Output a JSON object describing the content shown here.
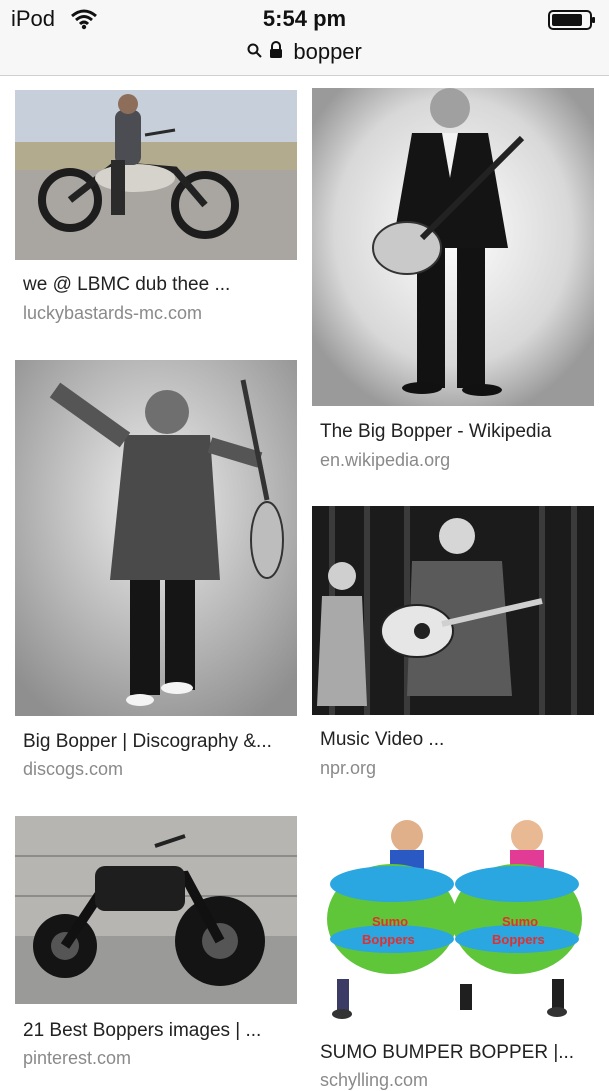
{
  "status": {
    "carrier": "iPod",
    "time": "5:54 pm",
    "query": "bopper"
  },
  "results": [
    {
      "title": "we @ LBMC dub thee ...",
      "source": "luckybastards-mc.com",
      "image": "man-on-chopper-motorcycle"
    },
    {
      "title": "The Big Bopper - Wikipedia",
      "source": "en.wikipedia.org",
      "image": "man-with-acoustic-guitar-bw"
    },
    {
      "title": "Big Bopper | Discography &...",
      "source": "discogs.com",
      "image": "performer-in-sparkle-jacket-with-guitar"
    },
    {
      "title": "Music Video ...",
      "source": "npr.org",
      "image": "performer-on-stage-with-telephone"
    },
    {
      "title": "21 Best Boppers images | ...",
      "source": "pinterest.com",
      "image": "black-bobber-motorcycle"
    },
    {
      "title": "SUMO BUMPER BOPPER |...",
      "source": "schylling.com",
      "image": "kids-in-inflatable-bumpers"
    }
  ],
  "toy_label": "Sumo Bumper Boppers",
  "toy_label_a": "Sumo",
  "toy_label_b": "Boppers"
}
